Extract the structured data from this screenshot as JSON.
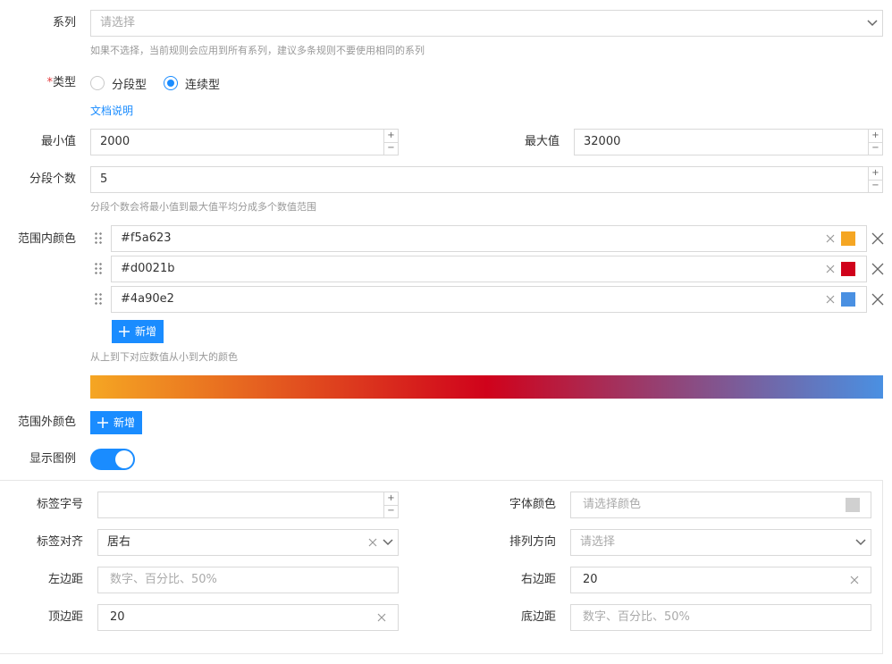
{
  "series": {
    "label": "系列",
    "placeholder": "请选择",
    "hint": "如果不选择，当前规则会应用到所有系列，建议多条规则不要使用相同的系列"
  },
  "type": {
    "required_mark": "*",
    "label": "类型",
    "options": [
      "分段型",
      "连续型"
    ],
    "selected": "连续型",
    "doc_link": "文档说明"
  },
  "min": {
    "label": "最小值",
    "value": "2000"
  },
  "max": {
    "label": "最大值",
    "value": "32000"
  },
  "segments": {
    "label": "分段个数",
    "value": "5",
    "hint": "分段个数会将最小值到最大值平均分成多个数值范围"
  },
  "in_range": {
    "label": "范围内颜色",
    "colors": [
      "#f5a623",
      "#d0021b",
      "#4a90e2"
    ],
    "add_label": "新增",
    "hint": "从上到下对应数值从小到大的颜色"
  },
  "out_range": {
    "label": "范围外颜色",
    "add_label": "新增"
  },
  "show_legend": {
    "label": "显示图例",
    "enabled": true
  },
  "legend": {
    "font_size": {
      "label": "标签字号",
      "value": ""
    },
    "font_color": {
      "label": "字体颜色",
      "placeholder": "请选择颜色"
    },
    "label_align": {
      "label": "标签对齐",
      "value": "居右"
    },
    "orient": {
      "label": "排列方向",
      "placeholder": "请选择"
    },
    "left": {
      "label": "左边距",
      "placeholder": "数字、百分比、50%"
    },
    "right": {
      "label": "右边距",
      "value": "20"
    },
    "top": {
      "label": "顶边距",
      "value": "20"
    },
    "bottom": {
      "label": "底边距",
      "placeholder": "数字、百分比、50%"
    }
  },
  "colors": {
    "accent": "#1a8cff",
    "required": "#e4393c"
  }
}
